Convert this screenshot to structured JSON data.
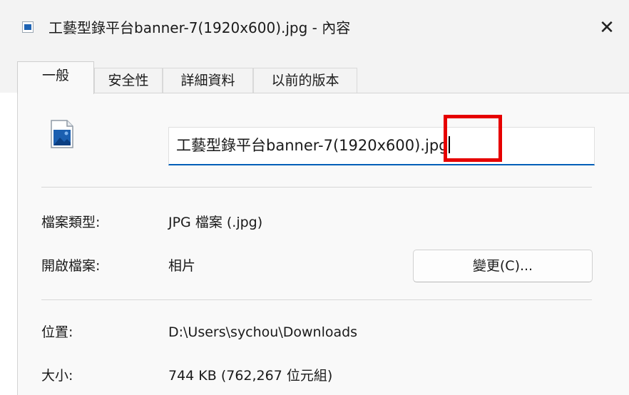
{
  "window": {
    "title": "工藝型錄平台banner-7(1920x600).jpg - 內容",
    "close_icon": "close-icon",
    "close_glyph": "✕"
  },
  "tabs": [
    {
      "label": "一般",
      "active": true
    },
    {
      "label": "安全性",
      "active": false
    },
    {
      "label": "詳細資料",
      "active": false
    },
    {
      "label": "以前的版本",
      "active": false
    }
  ],
  "general": {
    "file_icon": "image-file-icon",
    "file_name": "工藝型錄平台banner-7(1920x600).jpg",
    "file_type_label": "檔案類型:",
    "file_type_value": "JPG 檔案 (.jpg)",
    "opens_with_label": "開啟檔案:",
    "opens_with_value": "相片",
    "change_button": "變更(C)...",
    "location_label": "位置:",
    "location_value": "D:\\Users\\sychou\\Downloads",
    "size_label": "大小:",
    "size_value": "744 KB (762,267 位元組)"
  },
  "colors": {
    "accent": "#005fb8",
    "annotation": "#e60000"
  }
}
